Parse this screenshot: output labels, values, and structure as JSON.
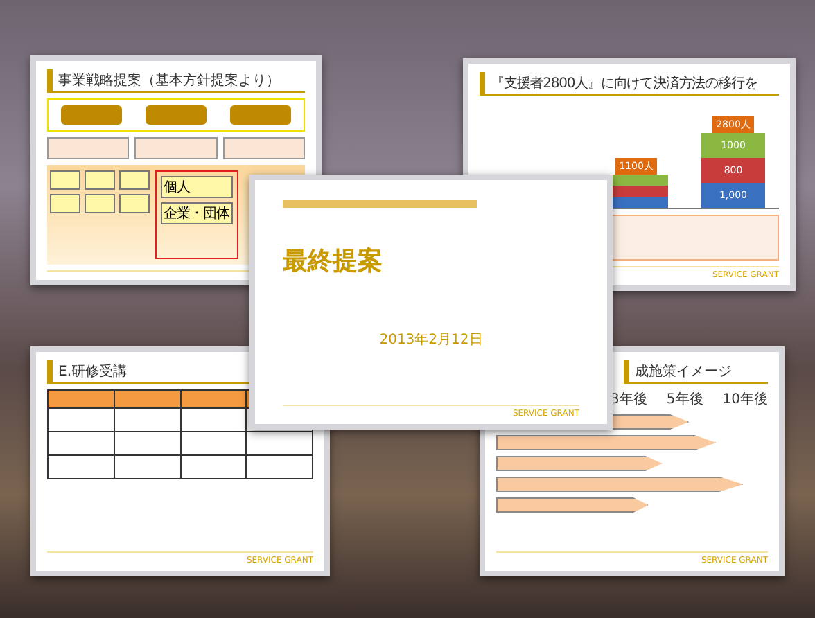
{
  "slides": [
    {
      "kind": "strategy",
      "title": "事業戦略提案（基本方針提案より）",
      "boxes": [
        "個人",
        "企業・団体"
      ]
    },
    {
      "kind": "chart",
      "title": "『支援者2800人』に向けて決済方法の移行を",
      "totals": [
        "1100人",
        "2800人"
      ],
      "segments": [
        "1000",
        "800",
        "1,000"
      ],
      "footer": "SERVICE GRANT"
    },
    {
      "kind": "table",
      "title": "E.研修受講",
      "footer": "SERVICE GRANT"
    },
    {
      "kind": "timeline",
      "title": "成施策イメージ",
      "years": [
        "3年後",
        "5年後",
        "10年後"
      ],
      "footer": "SERVICE GRANT"
    },
    {
      "kind": "cover",
      "title": "最終提案",
      "date": "2013年2月12日",
      "footer": "SERVICE GRANT"
    }
  ]
}
